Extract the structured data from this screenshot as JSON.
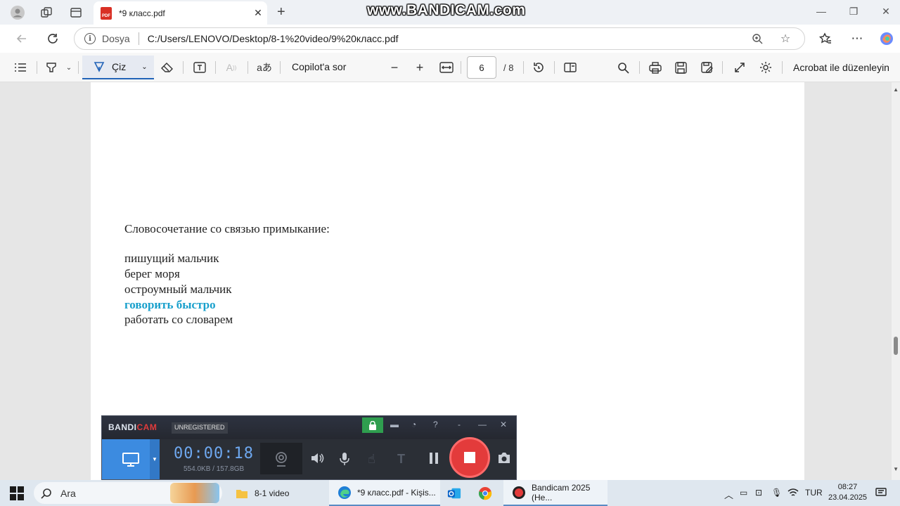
{
  "browser": {
    "tab_title": "*9 класс.pdf",
    "pdf_badge": "PDF",
    "site_label": "Dosya",
    "url": "C:/Users/LENOVO/Desktop/8-1%20video/9%20класс.pdf",
    "watermark": "www.BANDICAM.com"
  },
  "pdf_toolbar": {
    "draw_label": "Çiz",
    "copilot_label": "Copilot'a sor",
    "page_current": "6",
    "page_total": "/ 8",
    "acrobat_label": "Acrobat ile düzenleyin"
  },
  "document": {
    "heading": "Словосочетание со связью примыкание:",
    "lines": [
      "пишущий мальчик",
      "берег моря",
      "остроумный мальчик",
      "говорить быстро",
      "работать со словарем"
    ],
    "highlight_color": "#19a0cc"
  },
  "bandicam": {
    "logo_a": "BANDI",
    "logo_b": "CAM",
    "status": "UNREGISTERED",
    "timer": "00:00:18",
    "size": "554.0KB / 157.8GB"
  },
  "taskbar": {
    "search_label": "Ara",
    "tasks": [
      "8-1 video",
      "*9 класс.pdf - Kişis...",
      "Bandicam 2025 (He..."
    ],
    "language": "TUR",
    "time": "08:27",
    "date": "23.04.2025"
  }
}
